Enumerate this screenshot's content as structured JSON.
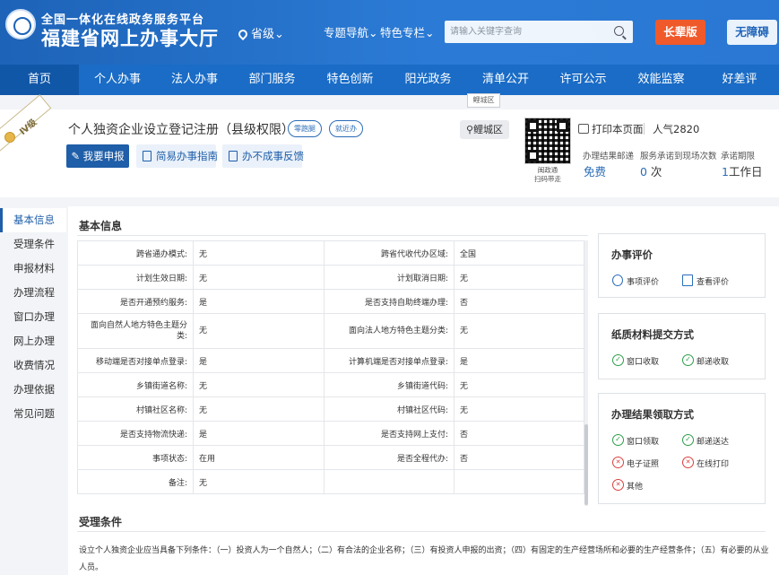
{
  "header": {
    "logo_line1": "全国一体化在线政务服务平台",
    "logo_line2": "福建省网上办事大厅",
    "region": "省级",
    "nav_topics": "专题导航",
    "nav_special": "特色专栏",
    "search_placeholder": "请输入关键字查询",
    "btn_elder": "长辈版",
    "btn_accessible": "无障碍"
  },
  "mainnav": {
    "items": [
      "首页",
      "个人办事",
      "法人办事",
      "部门服务",
      "特色创新",
      "阳光政务",
      "清单公开",
      "许可公示",
      "效能监察",
      "好差评"
    ],
    "tooltip": "鲤城区"
  },
  "item": {
    "level_badge": "Ⅳ级",
    "title": "个人独资企业设立登记注册（县级权限）",
    "tag1": "零跑腿",
    "tag2": "就近办",
    "btn_apply": "我要申报",
    "btn_guide": "简易办事指南",
    "btn_feedback": "办不成事反馈",
    "district": "鲤城区",
    "qr_caption1": "闽政通",
    "qr_caption2": "扫码带走",
    "print": "打印本页面",
    "popularity": "人气2820",
    "stats": [
      {
        "label": "办理结果邮递",
        "value": "免费",
        "unit": ""
      },
      {
        "label": "服务承诺到现场次数",
        "value": "0",
        "unit": " 次"
      },
      {
        "label": "承诺期限",
        "value": "1",
        "unit": "工作日"
      }
    ]
  },
  "leftnav": {
    "items": [
      "基本信息",
      "受理条件",
      "申报材料",
      "办理流程",
      "窗口办理",
      "网上办理",
      "收费情况",
      "办理依据",
      "常见问题"
    ]
  },
  "basic_info": {
    "title": "基本信息",
    "rows": [
      [
        "跨省通办模式:",
        "无",
        "跨省代收代办区域:",
        "全国"
      ],
      [
        "计划生效日期:",
        "无",
        "计划取消日期:",
        "无"
      ],
      [
        "是否开通预约服务:",
        "是",
        "是否支持自助终端办理:",
        "否"
      ],
      [
        "面向自然人地方特色主题分类:",
        "无",
        "面向法人地方特色主题分类:",
        "无"
      ],
      [
        "移动端是否对接单点登录:",
        "是",
        "计算机端是否对接单点登录:",
        "是"
      ],
      [
        "乡镇街道名称:",
        "无",
        "乡镇街道代码:",
        "无"
      ],
      [
        "村镇社区名称:",
        "无",
        "村镇社区代码:",
        "无"
      ],
      [
        "是否支持物流快递:",
        "是",
        "是否支持网上支付:",
        "否"
      ],
      [
        "事项状态:",
        "在用",
        "是否全程代办:",
        "否"
      ],
      [
        "备注:",
        "无",
        "",
        ""
      ]
    ]
  },
  "cards": {
    "evaluation": {
      "title": "办事评价",
      "items": [
        "事项评价",
        "查看评价"
      ]
    },
    "paper": {
      "title": "纸质材料提交方式",
      "items": [
        "窗口收取",
        "邮递收取"
      ]
    },
    "result": {
      "title": "办理结果领取方式",
      "items": [
        "窗口领取",
        "邮递送达",
        "电子证照",
        "在线打印",
        "其他"
      ]
    }
  },
  "accept": {
    "title": "受理条件",
    "text": "设立个人独资企业应当具备下列条件：（一）投资人为一个自然人；（二）有合法的企业名称；（三）有投资人申报的出资；（四）有固定的生产经营场所和必要的生产经营条件；（五）有必要的从业人员。"
  },
  "colors": {
    "brand": "#1a6cc6",
    "elder": "#f0592a",
    "ok": "#2e9d4a",
    "no": "#d9413d"
  }
}
